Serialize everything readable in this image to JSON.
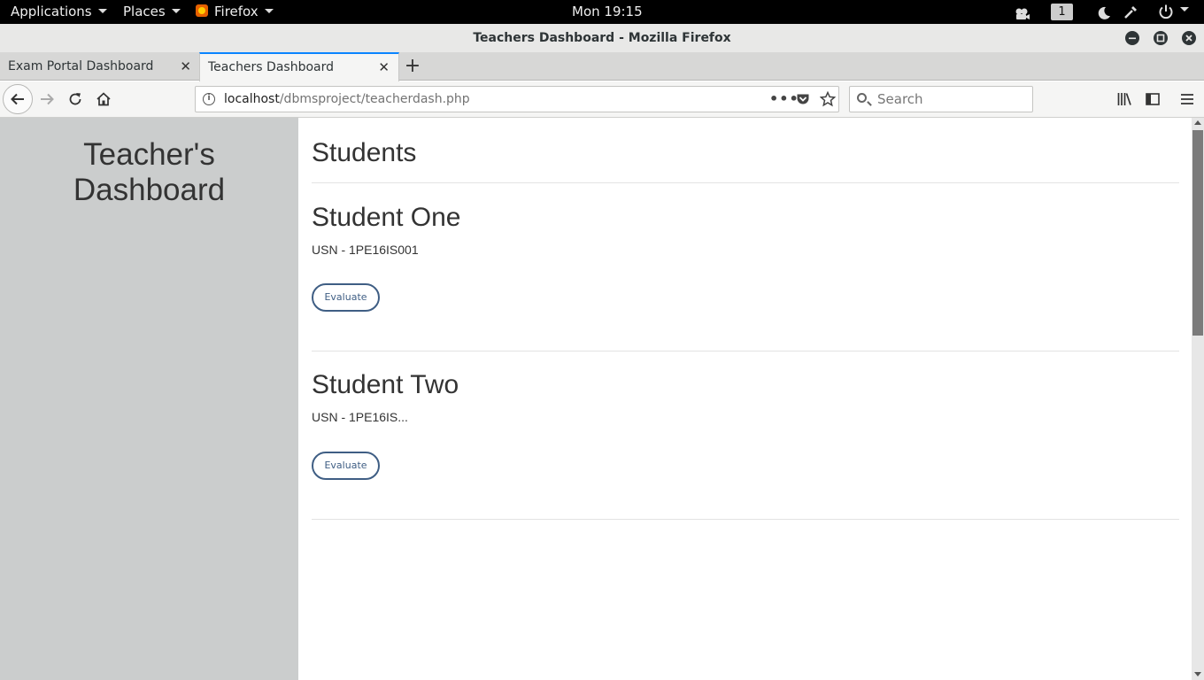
{
  "gnome_bar": {
    "applications": "Applications",
    "places": "Places",
    "firefox": "Firefox",
    "clock": "Mon 19:15",
    "workspace": "1"
  },
  "window": {
    "title": "Teachers Dashboard - Mozilla Firefox"
  },
  "tabs": [
    {
      "label": "Exam Portal Dashboard"
    },
    {
      "label": "Teachers Dashboard"
    }
  ],
  "navbar": {
    "url_host": "localhost",
    "url_path": "/dbmsproject/teacherdash.php",
    "search_placeholder": "Search"
  },
  "page": {
    "sidebar_title_line1": "Teacher's",
    "sidebar_title_line2": "Dashboard",
    "section_title": "Students",
    "students": [
      {
        "name": "Student One",
        "usn": "USN - 1PE16IS001",
        "button": "Evaluate"
      },
      {
        "name": "Student Two",
        "usn": "USN - 1PE16IS...",
        "button": "Evaluate"
      }
    ]
  },
  "colors": {
    "sidebar_bg": "#cbcdcd",
    "button_border": "#3f5e84",
    "active_tab_accent": "#0a84ff"
  }
}
